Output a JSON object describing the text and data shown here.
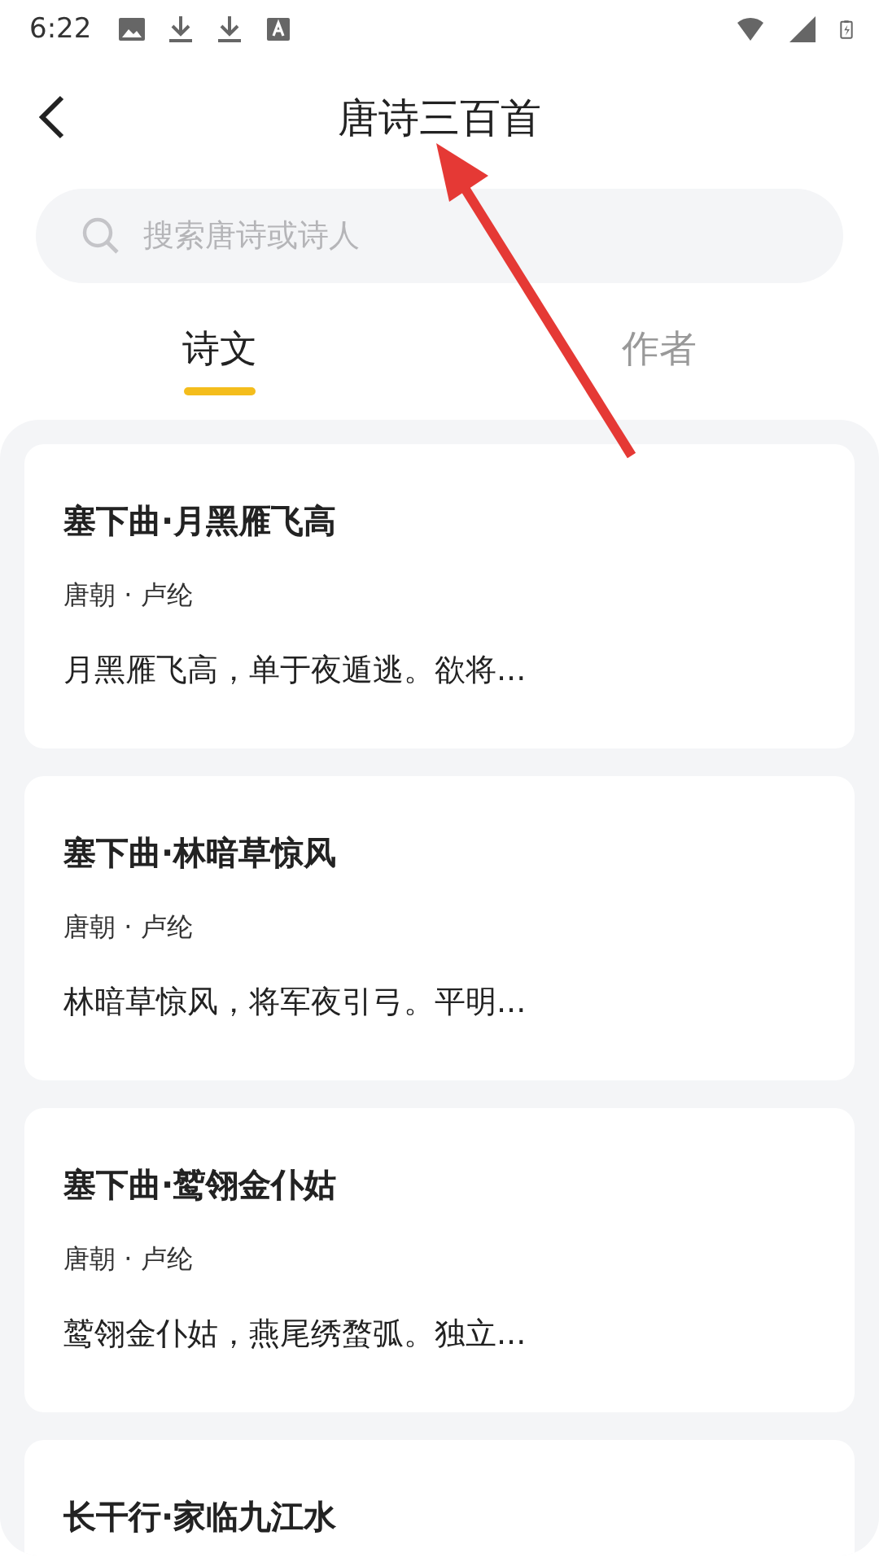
{
  "status_bar": {
    "time": "6:22"
  },
  "header": {
    "title": "唐诗三百首"
  },
  "search": {
    "placeholder": "搜索唐诗或诗人"
  },
  "tabs": [
    {
      "label": "诗文",
      "selected": true
    },
    {
      "label": "作者",
      "selected": false
    }
  ],
  "poems": [
    {
      "title": "塞下曲·月黑雁飞高",
      "meta": "唐朝 · 卢纶",
      "excerpt": "月黑雁飞高，单于夜遁逃。欲将..."
    },
    {
      "title": "塞下曲·林暗草惊风",
      "meta": "唐朝 · 卢纶",
      "excerpt": "林暗草惊风，将军夜引弓。平明..."
    },
    {
      "title": "塞下曲·鹫翎金仆姑",
      "meta": "唐朝 · 卢纶",
      "excerpt": "鹫翎金仆姑，燕尾绣蝥弧。独立..."
    },
    {
      "title": "长干行·家临九江水"
    }
  ]
}
